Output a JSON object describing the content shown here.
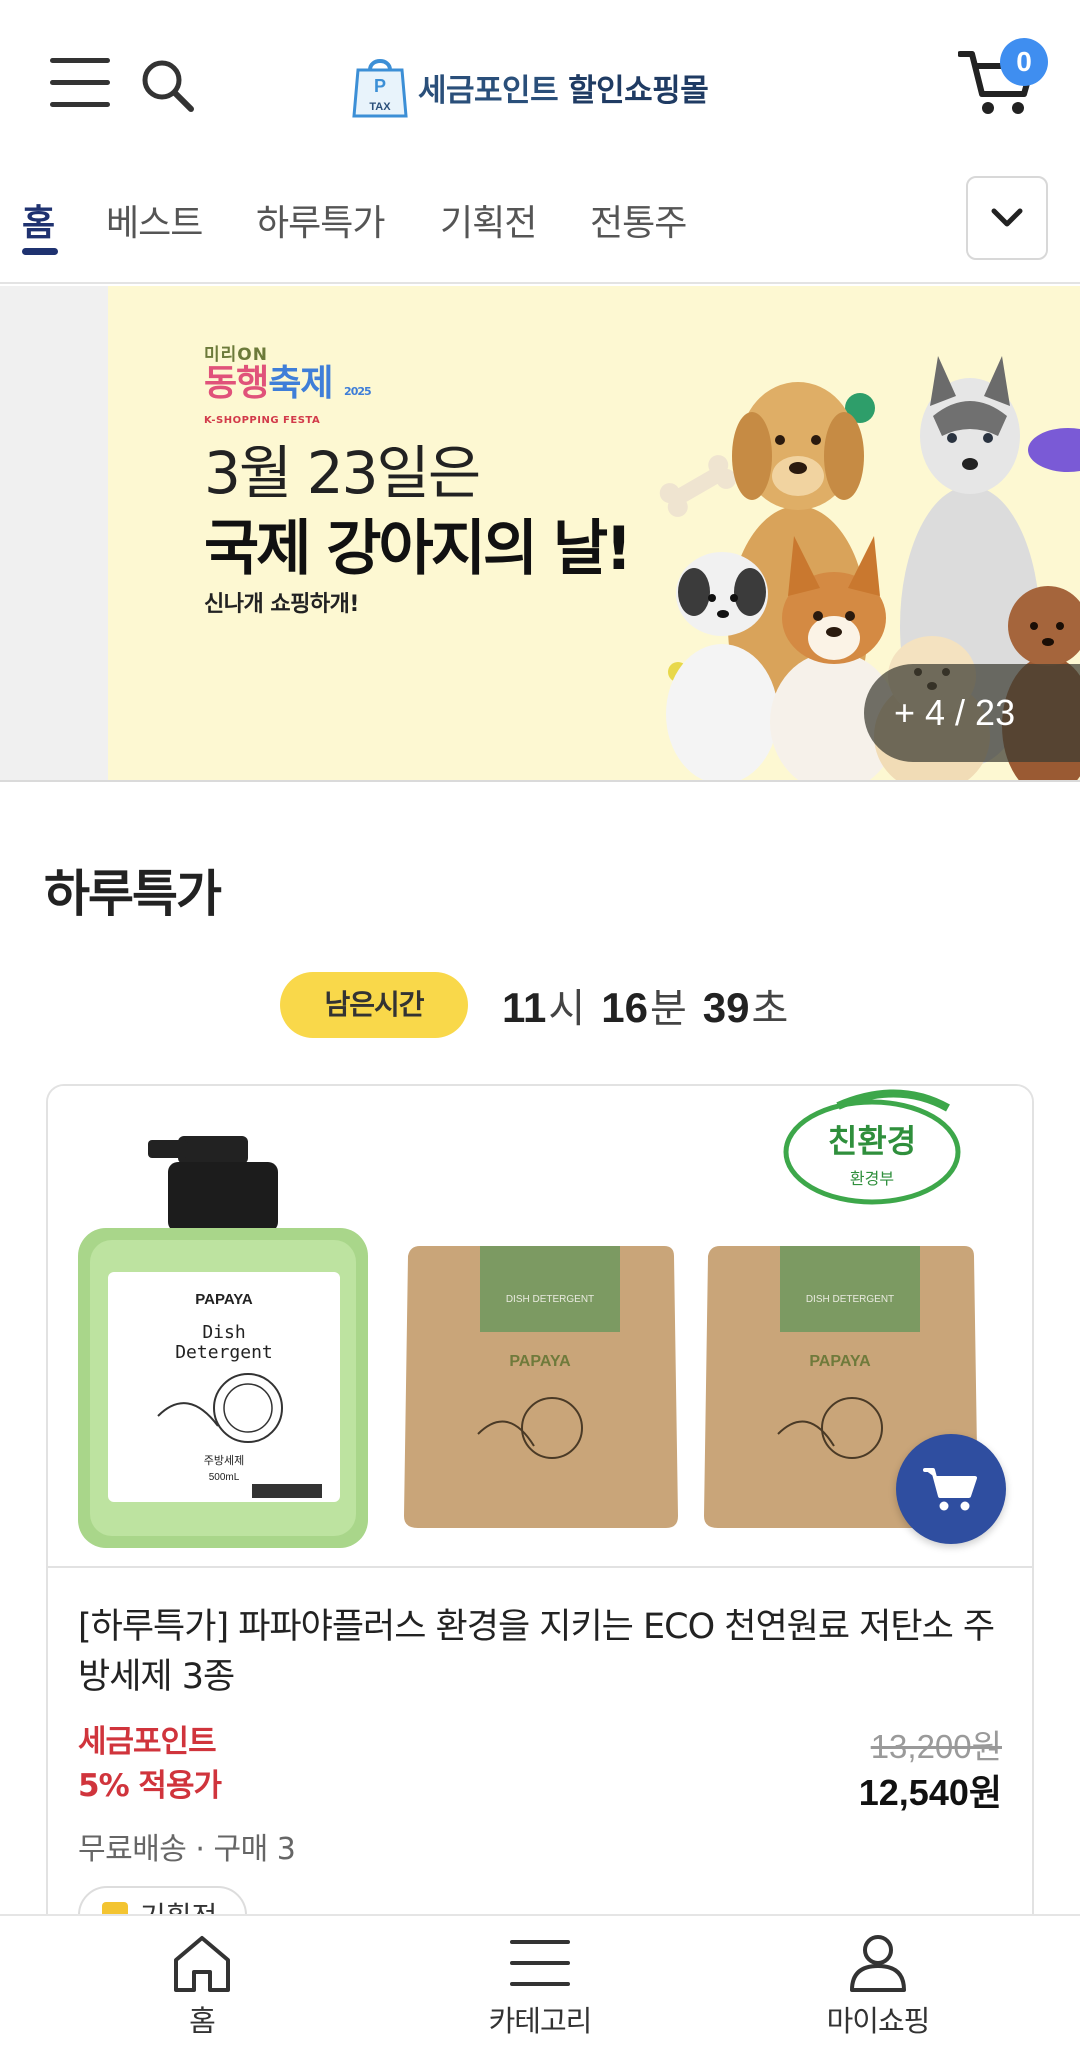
{
  "header": {
    "logo_text_1": "세금포인트",
    "logo_text_2": "할인쇼핑몰",
    "logo_bag_top": "P",
    "logo_bag_bottom": "TAX",
    "cart_count": "0"
  },
  "tabs": {
    "items": [
      "홈",
      "베스트",
      "하루특가",
      "기획전",
      "전통주"
    ],
    "active_index": 0
  },
  "banner": {
    "brand_top": "미리ON",
    "brand_main_a": "동행",
    "brand_main_b": "축제",
    "brand_year": "2025",
    "brand_sub": "K-SHOPPING FESTA",
    "line1": "3월 23일은",
    "line2": "국제 강아지의 날!",
    "line3": "신나개 쇼핑하개!",
    "counter": "+ 4 / 23"
  },
  "daily_deal": {
    "title": "하루특가",
    "timer_label": "남은시간",
    "hours": "11",
    "hours_unit": "시",
    "minutes": "16",
    "minutes_unit": "분",
    "seconds": "39",
    "seconds_unit": "초"
  },
  "product": {
    "eco_badge_main": "친환경",
    "eco_badge_sub": "환경부",
    "bottle_brand": "PAPAYA",
    "bottle_line1": "Dish",
    "bottle_line2": "Detergent",
    "bottle_label_small": "주방세제",
    "bottle_volume": "500mL",
    "pouch_brand": "PAPAYA",
    "pouch_header": "DISH DETERGENT",
    "title": "[하루특가] 파파야플러스 환경을 지키는 ECO 천연원료 저탄소 주방세제 3종",
    "tax_label_1": "세금포인트",
    "tax_label_2": "5% 적용가",
    "original_price": "13,200원",
    "sale_price": "12,540원",
    "shipping": "무료배송 · 구매 3",
    "promo_tag": "기획전"
  },
  "bottom_nav": {
    "home": "홈",
    "category": "카테고리",
    "my": "마이쇼핑"
  },
  "colors": {
    "accent_navy": "#1f3270",
    "timer_badge": "#f9d84a",
    "tax_red": "#d0343c",
    "cart_fab": "#2f4ea0",
    "badge_blue": "#3f8ef0",
    "banner_bg": "#fdf8d2"
  }
}
